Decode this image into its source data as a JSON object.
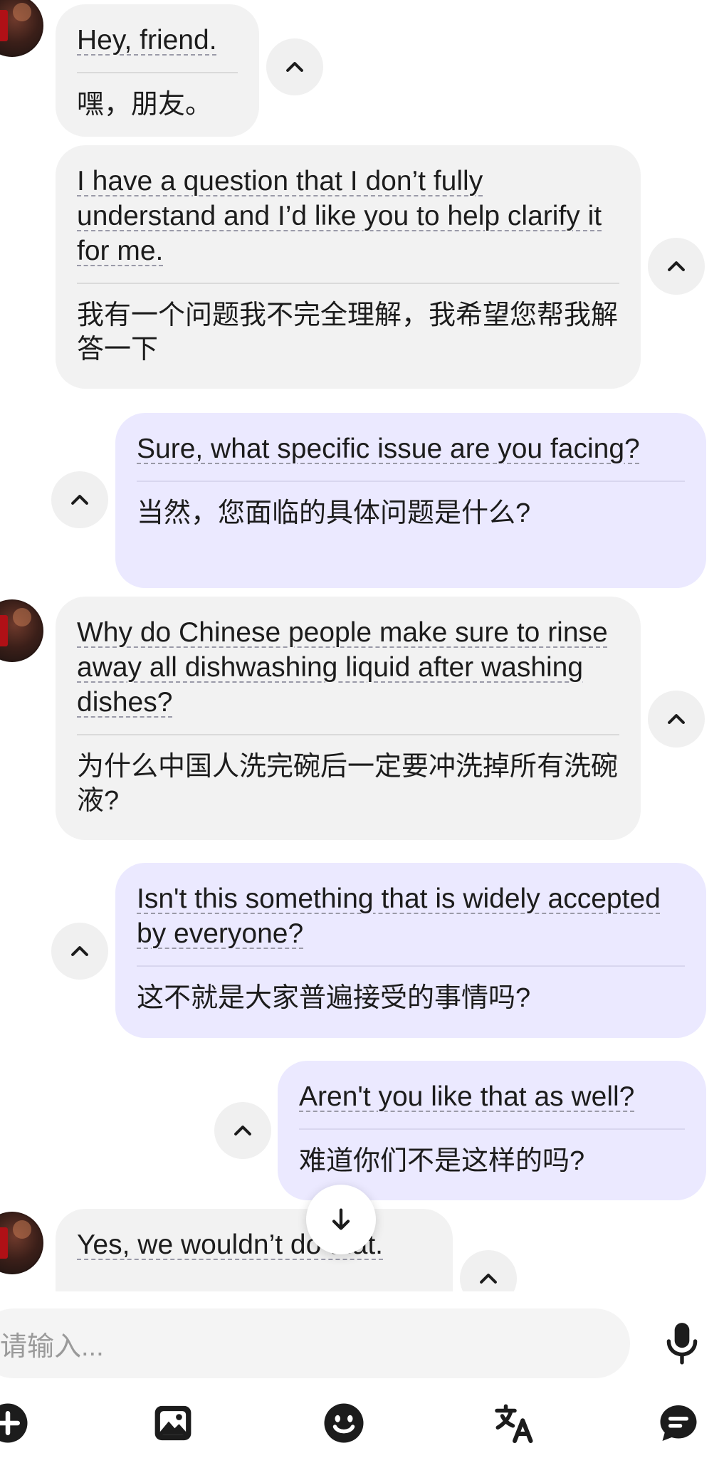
{
  "messages": [
    {
      "sender": "them",
      "en": "Hey, friend.",
      "zh": "嘿，朋友。"
    },
    {
      "sender": "them",
      "en": "I have a question that I don’t fully understand and I’d like you to help clarify it for me.",
      "zh": "我有一个问题我不完全理解，我希望您帮我解答一下"
    },
    {
      "sender": "me",
      "en": "Sure, what specific issue are you facing?",
      "zh": "当然，您面临的具体问题是什么?"
    },
    {
      "sender": "them",
      "en": "Why do Chinese people make sure to rinse away all dishwashing liquid after washing dishes?",
      "zh": "为什么中国人洗完碗后一定要冲洗掉所有洗碗液?"
    },
    {
      "sender": "me",
      "en": "Isn't this something that is widely accepted by everyone?",
      "zh": "这不就是大家普遍接受的事情吗?"
    },
    {
      "sender": "me",
      "en": "Aren't you like that as well?",
      "zh": "难道你们不是这样的吗?"
    },
    {
      "sender": "them",
      "en": "Yes, we wouldn’t do that.",
      "zh": ""
    }
  ],
  "composer": {
    "placeholder": "请输入..."
  },
  "icons": {
    "collapse": "chevron-up-icon",
    "scroll_down": "arrow-down-icon",
    "mic": "microphone-icon",
    "add": "plus-circle-icon",
    "image": "image-icon",
    "emoji": "smiley-icon",
    "translate": "translate-icon",
    "quick_reply": "chat-bubble-icon"
  },
  "colors": {
    "incoming_bubble": "#f2f2f2",
    "outgoing_bubble": "#ebe9ff",
    "text": "#1c1c1c",
    "placeholder": "#9a9a9a",
    "button_bg": "#f0f0f0"
  }
}
